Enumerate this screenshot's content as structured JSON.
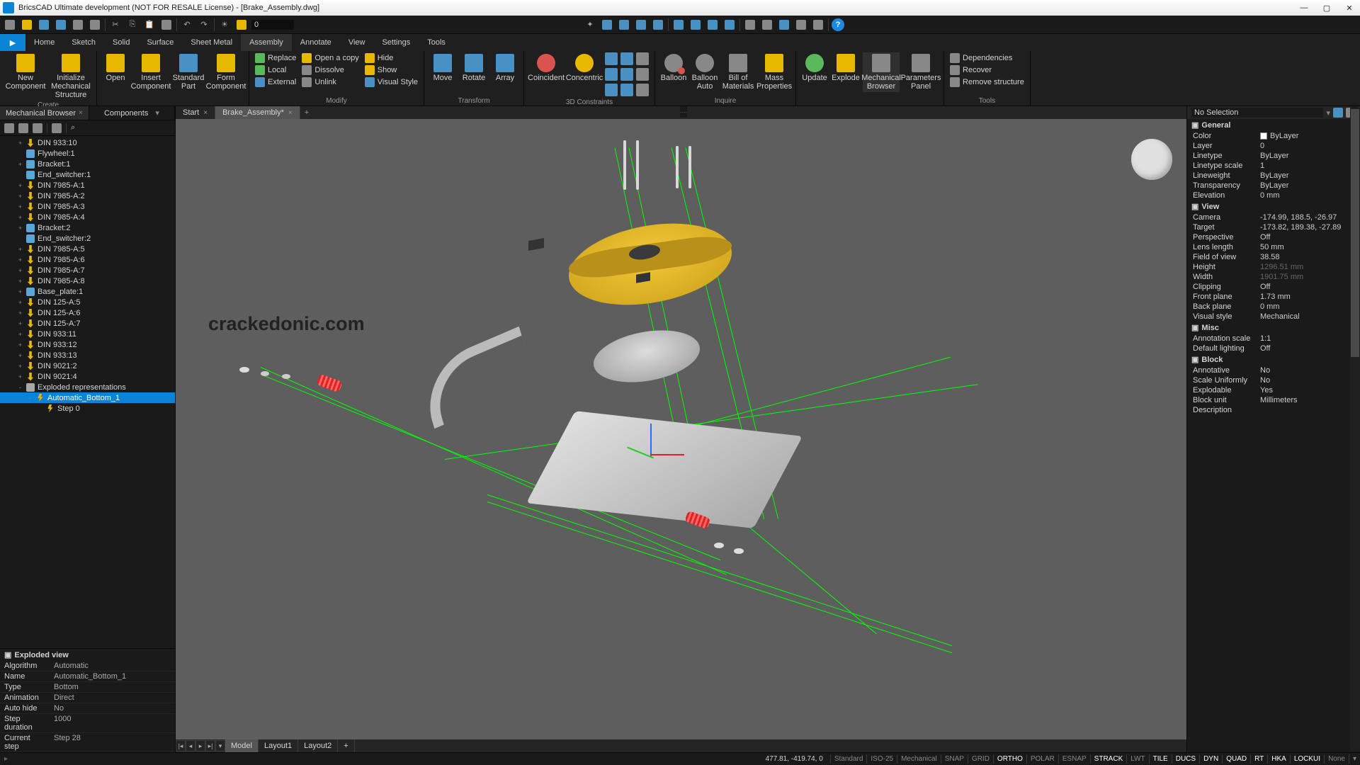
{
  "title": "BricsCAD Ultimate development (NOT FOR RESALE License) - [Brake_Assembly.dwg]",
  "menus": [
    "Home",
    "Sketch",
    "Solid",
    "Surface",
    "Sheet Metal",
    "Assembly",
    "Annotate",
    "View",
    "Settings",
    "Tools"
  ],
  "active_menu": "Assembly",
  "ribbon": {
    "create": {
      "title": "Create",
      "new": "New Component",
      "init": "Initialize Mechanical Structure"
    },
    "insert": {
      "open": "Open",
      "insert": "Insert Component",
      "std": "Standard Part",
      "form": "Form Component"
    },
    "modify": {
      "title": "Modify",
      "replace": "Replace",
      "opencopy": "Open a copy",
      "hide": "Hide",
      "local": "Local",
      "dissolve": "Dissolve",
      "show": "Show",
      "external": "External",
      "unlink": "Unlink",
      "vstyle": "Visual Style"
    },
    "transform": {
      "title": "Transform",
      "move": "Move",
      "rotate": "Rotate",
      "array": "Array"
    },
    "constraints": {
      "title": "3D Constraints",
      "coincident": "Coincident",
      "concentric": "Concentric"
    },
    "inquire": {
      "title": "Inquire",
      "balloon": "Balloon",
      "balloonauto": "Balloon Auto",
      "bom": "Bill of Materials",
      "mass": "Mass Properties"
    },
    "misc": {
      "update": "Update",
      "explode": "Explode",
      "mbrowser": "Mechanical Browser",
      "ppanel": "Parameters Panel"
    },
    "tools": {
      "title": "Tools",
      "deps": "Dependencies",
      "recover": "Recover",
      "remove": "Remove structure"
    }
  },
  "panel_tabs": {
    "mech": "Mechanical Browser",
    "comp": "Components"
  },
  "tree": [
    {
      "l": 1,
      "i": "bolt",
      "t": "DIN 933:10",
      "e": "+"
    },
    {
      "l": 1,
      "i": "part",
      "t": "Flywheel:1"
    },
    {
      "l": 1,
      "i": "part",
      "t": "Bracket:1",
      "e": "+"
    },
    {
      "l": 1,
      "i": "part",
      "t": "End_switcher:1"
    },
    {
      "l": 1,
      "i": "bolt",
      "t": "DIN 7985-A:1",
      "e": "+"
    },
    {
      "l": 1,
      "i": "bolt",
      "t": "DIN 7985-A:2",
      "e": "+"
    },
    {
      "l": 1,
      "i": "bolt",
      "t": "DIN 7985-A:3",
      "e": "+"
    },
    {
      "l": 1,
      "i": "bolt",
      "t": "DIN 7985-A:4",
      "e": "+"
    },
    {
      "l": 1,
      "i": "part",
      "t": "Bracket:2",
      "e": "+"
    },
    {
      "l": 1,
      "i": "part",
      "t": "End_switcher:2"
    },
    {
      "l": 1,
      "i": "bolt",
      "t": "DIN 7985-A:5",
      "e": "+"
    },
    {
      "l": 1,
      "i": "bolt",
      "t": "DIN 7985-A:6",
      "e": "+"
    },
    {
      "l": 1,
      "i": "bolt",
      "t": "DIN 7985-A:7",
      "e": "+"
    },
    {
      "l": 1,
      "i": "bolt",
      "t": "DIN 7985-A:8",
      "e": "+"
    },
    {
      "l": 1,
      "i": "part",
      "t": "Base_plate:1",
      "e": "+"
    },
    {
      "l": 1,
      "i": "bolt",
      "t": "DIN 125-A:5",
      "e": "+"
    },
    {
      "l": 1,
      "i": "bolt",
      "t": "DIN 125-A:6",
      "e": "+"
    },
    {
      "l": 1,
      "i": "bolt",
      "t": "DIN 125-A:7",
      "e": "+"
    },
    {
      "l": 1,
      "i": "bolt",
      "t": "DIN 933:11",
      "e": "+"
    },
    {
      "l": 1,
      "i": "bolt",
      "t": "DIN 933:12",
      "e": "+"
    },
    {
      "l": 1,
      "i": "bolt",
      "t": "DIN 933:13",
      "e": "+"
    },
    {
      "l": 1,
      "i": "bolt",
      "t": "DIN 9021:2",
      "e": "+"
    },
    {
      "l": 1,
      "i": "bolt",
      "t": "DIN 9021:4",
      "e": "+"
    },
    {
      "l": 1,
      "i": "cam",
      "t": "Exploded representations",
      "e": "-"
    },
    {
      "l": 2,
      "i": "lightning",
      "t": "Automatic_Bottom_1",
      "e": "-",
      "sel": true
    },
    {
      "l": 3,
      "i": "lightning",
      "t": "Step 0"
    }
  ],
  "exploded": {
    "title": "Exploded view",
    "rows": [
      [
        "Algorithm",
        "Automatic"
      ],
      [
        "Name",
        "Automatic_Bottom_1"
      ],
      [
        "Type",
        "Bottom"
      ],
      [
        "Animation",
        "Direct"
      ],
      [
        "Auto hide",
        "No"
      ],
      [
        "Step duration",
        "1000"
      ],
      [
        "Current step",
        "Step 28"
      ]
    ]
  },
  "doctabs": {
    "start": "Start",
    "file": "Brake_Assembly*"
  },
  "watermark": "crackedonic.com",
  "layout": {
    "model": "Model",
    "l1": "Layout1",
    "l2": "Layout2"
  },
  "props": {
    "selection": "No Selection",
    "general": {
      "title": "General",
      "color_l": "Color",
      "color_v": "ByLayer",
      "layer_l": "Layer",
      "layer_v": "0",
      "lt_l": "Linetype",
      "lt_v": "ByLayer",
      "lts_l": "Linetype scale",
      "lts_v": "1",
      "lw_l": "Lineweight",
      "lw_v": "ByLayer",
      "tr_l": "Transparency",
      "tr_v": "ByLayer",
      "el_l": "Elevation",
      "el_v": "0 mm"
    },
    "view": {
      "title": "View",
      "cam_l": "Camera",
      "cam_v": "-174.99, 188.5, -26.97",
      "tgt_l": "Target",
      "tgt_v": "-173.82, 189.38, -27.89",
      "persp_l": "Perspective",
      "persp_v": "Off",
      "lens_l": "Lens length",
      "lens_v": "50 mm",
      "fov_l": "Field of view",
      "fov_v": "38.58",
      "h_l": "Height",
      "h_v": "1296.51 mm",
      "w_l": "Width",
      "w_v": "1901.75 mm",
      "clip_l": "Clipping",
      "clip_v": "Off",
      "fp_l": "Front plane",
      "fp_v": "1.73 mm",
      "bp_l": "Back plane",
      "bp_v": "0 mm",
      "vs_l": "Visual style",
      "vs_v": "Mechanical"
    },
    "misc": {
      "title": "Misc",
      "as_l": "Annotation scale",
      "as_v": "1:1",
      "dl_l": "Default lighting",
      "dl_v": "Off"
    },
    "block": {
      "title": "Block",
      "an_l": "Annotative",
      "an_v": "No",
      "su_l": "Scale Uniformly",
      "su_v": "No",
      "ex_l": "Explodable",
      "ex_v": "Yes",
      "bu_l": "Block unit",
      "bu_v": "Millimeters",
      "de_l": "Description",
      "de_v": ""
    }
  },
  "status": {
    "coords": "477.81, -419.74, 0",
    "items": [
      {
        "t": "Standard"
      },
      {
        "t": "ISO-25"
      },
      {
        "t": "Mechanical"
      },
      {
        "t": "SNAP"
      },
      {
        "t": "GRID"
      },
      {
        "t": "ORTHO",
        "on": true
      },
      {
        "t": "POLAR"
      },
      {
        "t": "ESNAP"
      },
      {
        "t": "STRACK",
        "on": true
      },
      {
        "t": "LWT"
      },
      {
        "t": "TILE",
        "on": true
      },
      {
        "t": "DUCS",
        "on": true
      },
      {
        "t": "DYN",
        "on": true
      },
      {
        "t": "QUAD",
        "on": true
      },
      {
        "t": "RT",
        "on": true
      },
      {
        "t": "HKA",
        "on": true
      },
      {
        "t": "LOCKUI",
        "on": true
      },
      {
        "t": "None"
      }
    ]
  }
}
